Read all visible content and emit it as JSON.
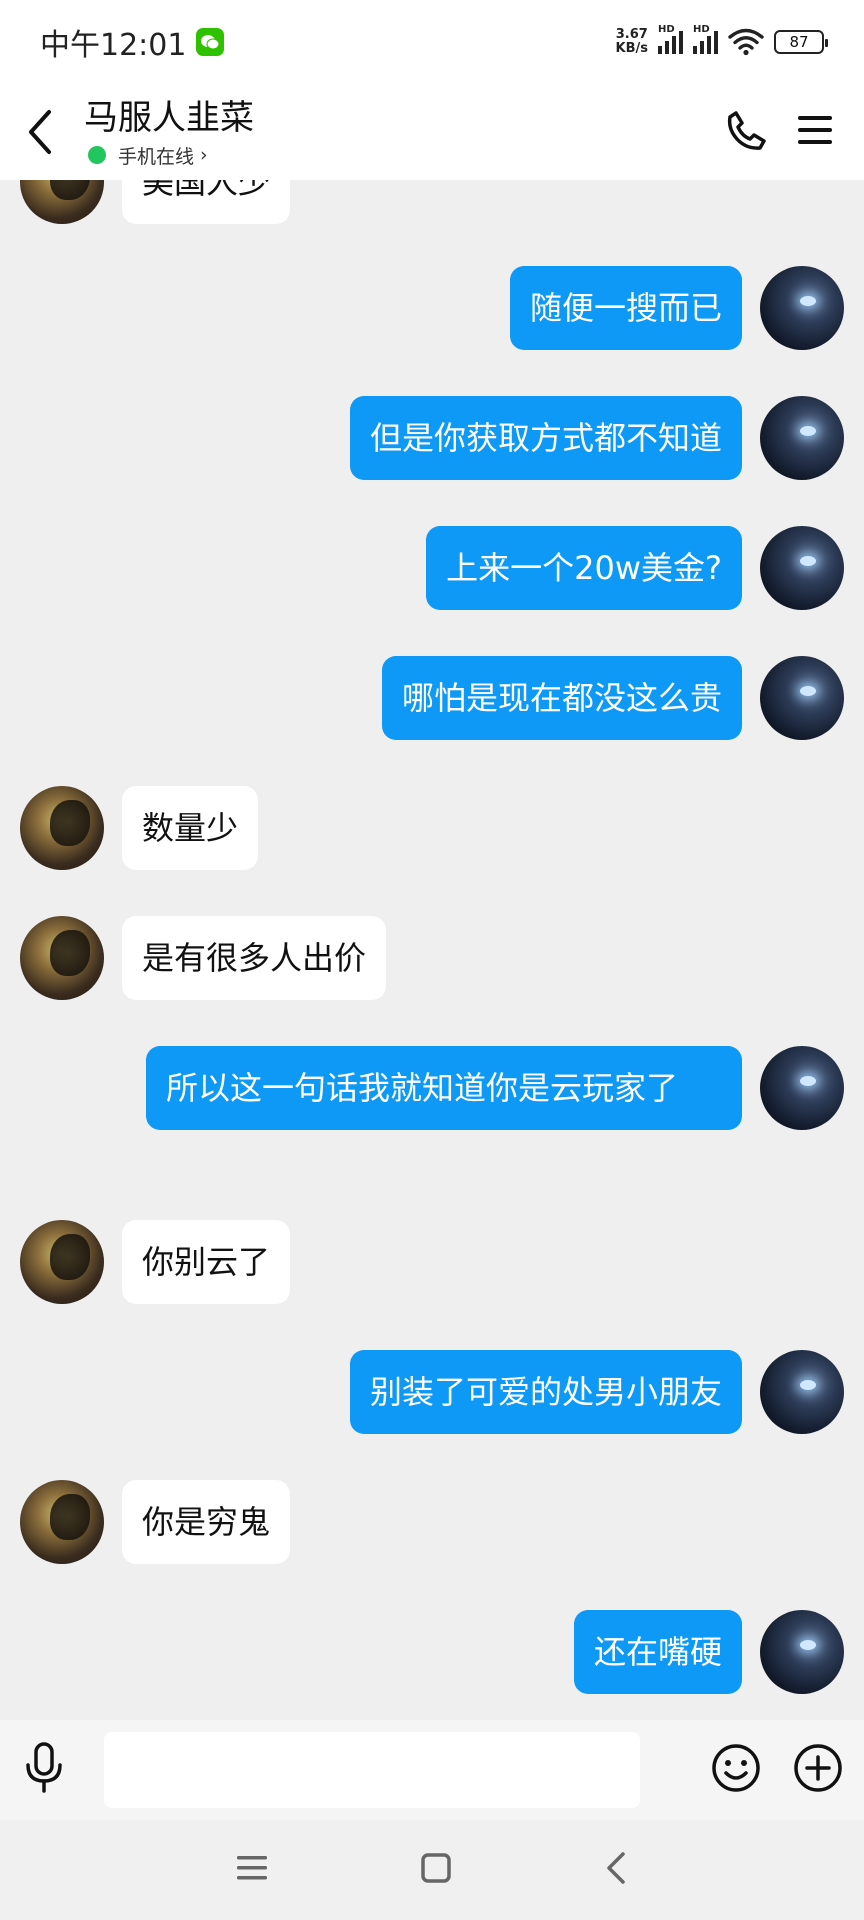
{
  "status_bar": {
    "time": "中午12:01",
    "net_speed_value": "3.67",
    "net_speed_unit": "KB/s",
    "network_type_1": "HD",
    "network_type_2": "HD",
    "battery": "87"
  },
  "header": {
    "contact_name": "马服人韭菜",
    "online_status": "手机在线",
    "online_chevron": "›"
  },
  "messages": [
    {
      "side": "left",
      "text": "美国人少"
    },
    {
      "side": "right",
      "text": "随便一搜而已"
    },
    {
      "side": "right",
      "text": "但是你获取方式都不知道"
    },
    {
      "side": "right",
      "text": "上来一个20w美金?"
    },
    {
      "side": "right",
      "text": "哪怕是现在都没这么贵"
    },
    {
      "side": "left",
      "text": "数量少"
    },
    {
      "side": "left",
      "text": "是有很多人出价"
    },
    {
      "side": "right",
      "text": "所以这一句话我就知道你是云玩家了"
    },
    {
      "side": "left",
      "text": "你别云了"
    },
    {
      "side": "right",
      "text": "别装了可爱的处男小朋友"
    },
    {
      "side": "left",
      "text": "你是穷鬼"
    },
    {
      "side": "right",
      "text": "还在嘴硬"
    }
  ],
  "input": {
    "value": "",
    "placeholder": ""
  },
  "icons": {
    "back": "chevron-left-icon",
    "call": "phone-icon",
    "menu": "menu-icon",
    "voice": "microphone-icon",
    "emoji": "emoji-icon",
    "plus": "plus-circle-icon"
  },
  "colors": {
    "self_bubble": "#0d99f5",
    "other_bubble": "#ffffff",
    "online_dot": "#22c55e",
    "chat_background": "#efefef"
  }
}
